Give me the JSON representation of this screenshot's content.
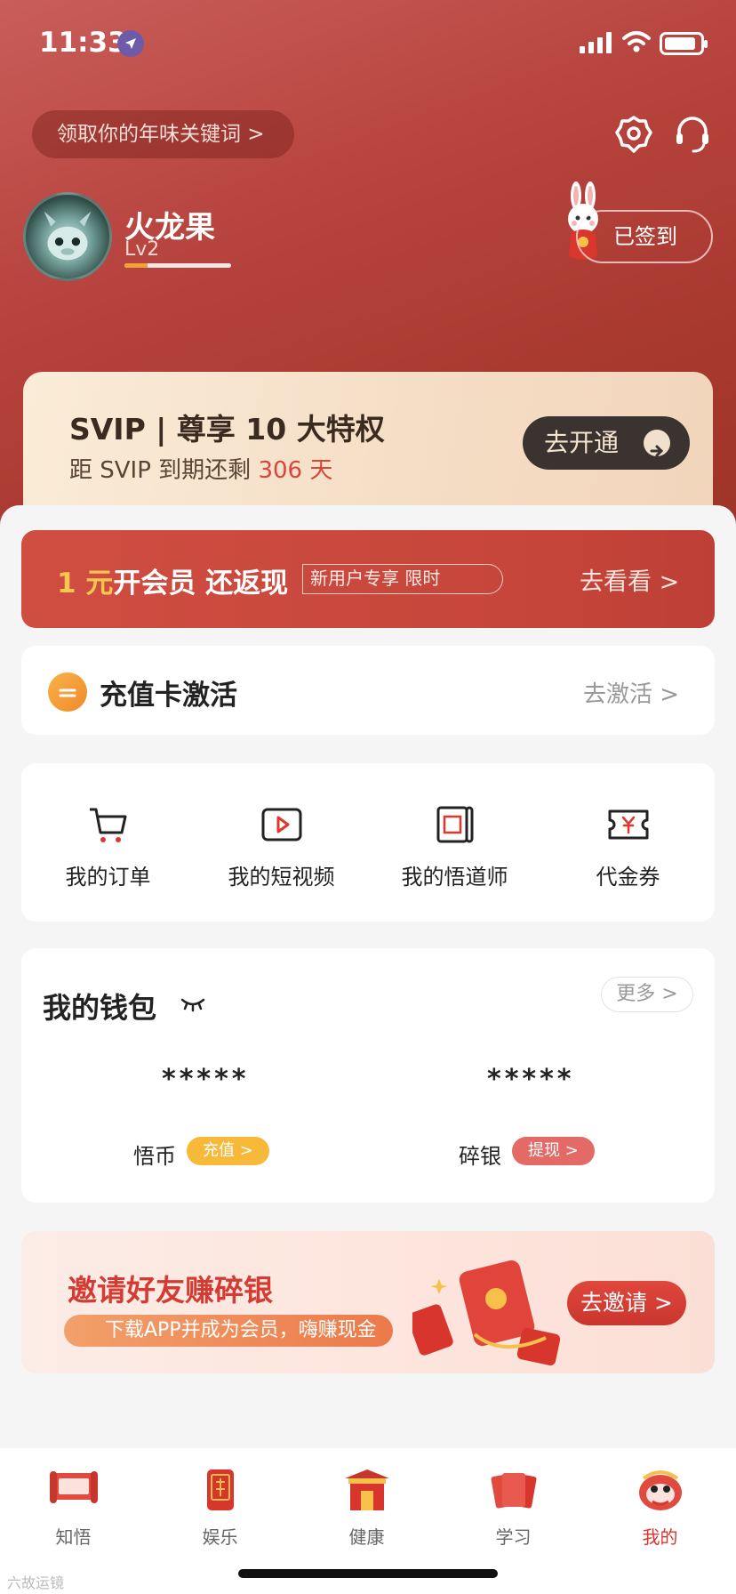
{
  "status_bar": {
    "time": "11:33"
  },
  "header": {
    "keyword_pill": "领取你的年味关键词 >",
    "icons": [
      "settings-icon",
      "customer-service-icon"
    ]
  },
  "profile": {
    "username": "火龙果",
    "level": "Lv2",
    "level_progress": 0.22,
    "signin_label": "已签到"
  },
  "svip": {
    "title": "SVIP | 尊享 10 大特权",
    "subtitle_prefix": "距 SVIP 到期还剩",
    "days": "306 天",
    "button": "去开通"
  },
  "promo": {
    "price": "1 元",
    "main": "开会员 还返现",
    "tag": "新用户专享 限时",
    "action": "去看看 >"
  },
  "recharge": {
    "label": "充值卡激活",
    "action": "去激活 >"
  },
  "shortcuts": [
    {
      "label": "我的订单",
      "icon": "cart-icon"
    },
    {
      "label": "我的短视频",
      "icon": "video-play-icon"
    },
    {
      "label": "我的悟道师",
      "icon": "mentor-scroll-icon"
    },
    {
      "label": "代金券",
      "icon": "voucher-icon"
    }
  ],
  "wallet": {
    "title": "我的钱包",
    "more": "更多 >",
    "items": [
      {
        "value": "*****",
        "label": "悟币",
        "badge": "充值 >"
      },
      {
        "value": "*****",
        "label": "碎银",
        "badge": "提现 >"
      }
    ]
  },
  "invite": {
    "title": "邀请好友赚碎银",
    "subtitle": "下载APP并成为会员，嗨赚现金",
    "button": "去邀请 >"
  },
  "tabbar": [
    {
      "label": "知悟",
      "active": false
    },
    {
      "label": "娱乐",
      "active": false
    },
    {
      "label": "健康",
      "active": false
    },
    {
      "label": "学习",
      "active": false
    },
    {
      "label": "我的",
      "active": true
    }
  ],
  "watermark": "六故运镜",
  "colors": {
    "accent": "#d8352c",
    "hero": "#b8453f",
    "svip_bg": "#f5dec6",
    "coin": "#f6b93a"
  }
}
